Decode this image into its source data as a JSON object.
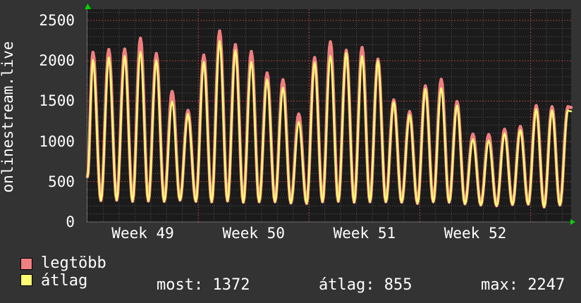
{
  "legend": {
    "items": [
      {
        "label": "legtöbb",
        "color": "#f08080"
      },
      {
        "label": "átlag",
        "color": "#ffff73"
      }
    ]
  },
  "stats": {
    "items": [
      {
        "label": "most:",
        "value": "1372"
      },
      {
        "label": "átlag:",
        "value": "855"
      },
      {
        "label": "max:",
        "value": "2247"
      }
    ]
  },
  "chart_data": {
    "type": "line",
    "title": "onlinestream.live",
    "x_tick_labels": [
      "Week 49",
      "Week 50",
      "Week 51",
      "Week 52"
    ],
    "x_unit": "day",
    "days": 31,
    "days_per_week": 7,
    "y_ticks": [
      0,
      500,
      1000,
      1500,
      2000,
      2500
    ],
    "y_minor_step": 100,
    "ylim": [
      0,
      2640
    ],
    "grid": {
      "minor_color": "#525252",
      "major_color": "#9e4343"
    },
    "axis_color": "#6f6f6f",
    "arrow_color": "#00d400",
    "plot_bg": "#1b1b1b",
    "page_bg": "#333333",
    "start_value": 560,
    "peak_fraction": 0.35,
    "trough_fraction": 0.85,
    "series": [
      {
        "name": "legtöbb",
        "color": "#f07e7e",
        "stroke_width": 4.5,
        "daily_peaks": [
          2105,
          2140,
          2145,
          2280,
          2090,
          1620,
          1385,
          2070,
          2370,
          2200,
          2115,
          1850,
          1765,
          1340,
          2040,
          2235,
          2130,
          2165,
          2020,
          1515,
          1370,
          1690,
          1770,
          1495,
          1090,
          1085,
          1150,
          1185,
          1445,
          1430,
          1430
        ]
      },
      {
        "name": "átlag",
        "color": "#ffff73",
        "stroke_width": 2.5,
        "daily_peaks": [
          2010,
          2040,
          2060,
          2110,
          2005,
          1495,
          1340,
          1985,
          2245,
          2130,
          1985,
          1770,
          1665,
          1240,
          1980,
          2060,
          2100,
          2060,
          2000,
          1490,
          1330,
          1650,
          1660,
          1445,
          1025,
          1010,
          1100,
          1140,
          1400,
          1385,
          1382
        ]
      }
    ],
    "daily_troughs": [
      265,
      270,
      255,
      260,
      255,
      270,
      255,
      250,
      260,
      245,
      250,
      250,
      235,
      230,
      250,
      255,
      245,
      250,
      250,
      245,
      230,
      250,
      245,
      225,
      210,
      200,
      215,
      220,
      185,
      210
    ],
    "current": 1372,
    "average": 855,
    "maximum": 2247
  }
}
